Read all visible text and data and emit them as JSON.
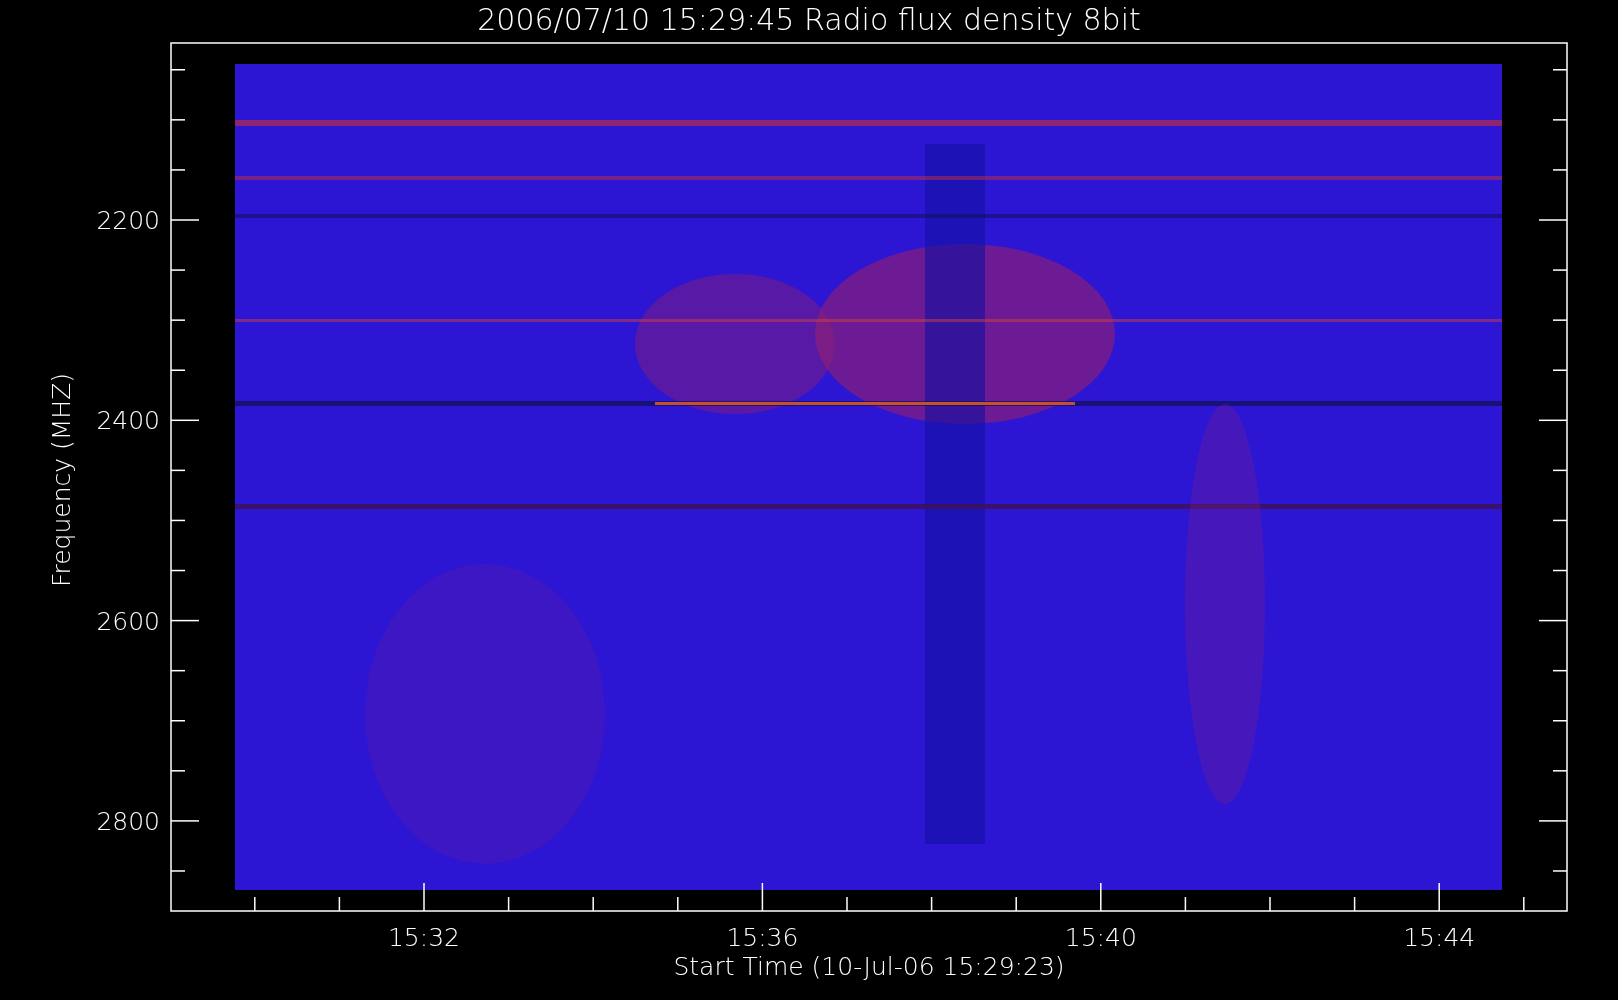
{
  "title": "2006/07/10 15:29:45 Radio flux density 8bit",
  "y_axis": {
    "label": "Frequency (MHZ)",
    "ticks": [
      "2200",
      "2400",
      "2600",
      "2800"
    ]
  },
  "x_axis": {
    "label": "Start Time (10-Jul-06 15:29:23)",
    "ticks": [
      "15:32",
      "15:36",
      "15:40",
      "15:44"
    ]
  }
}
